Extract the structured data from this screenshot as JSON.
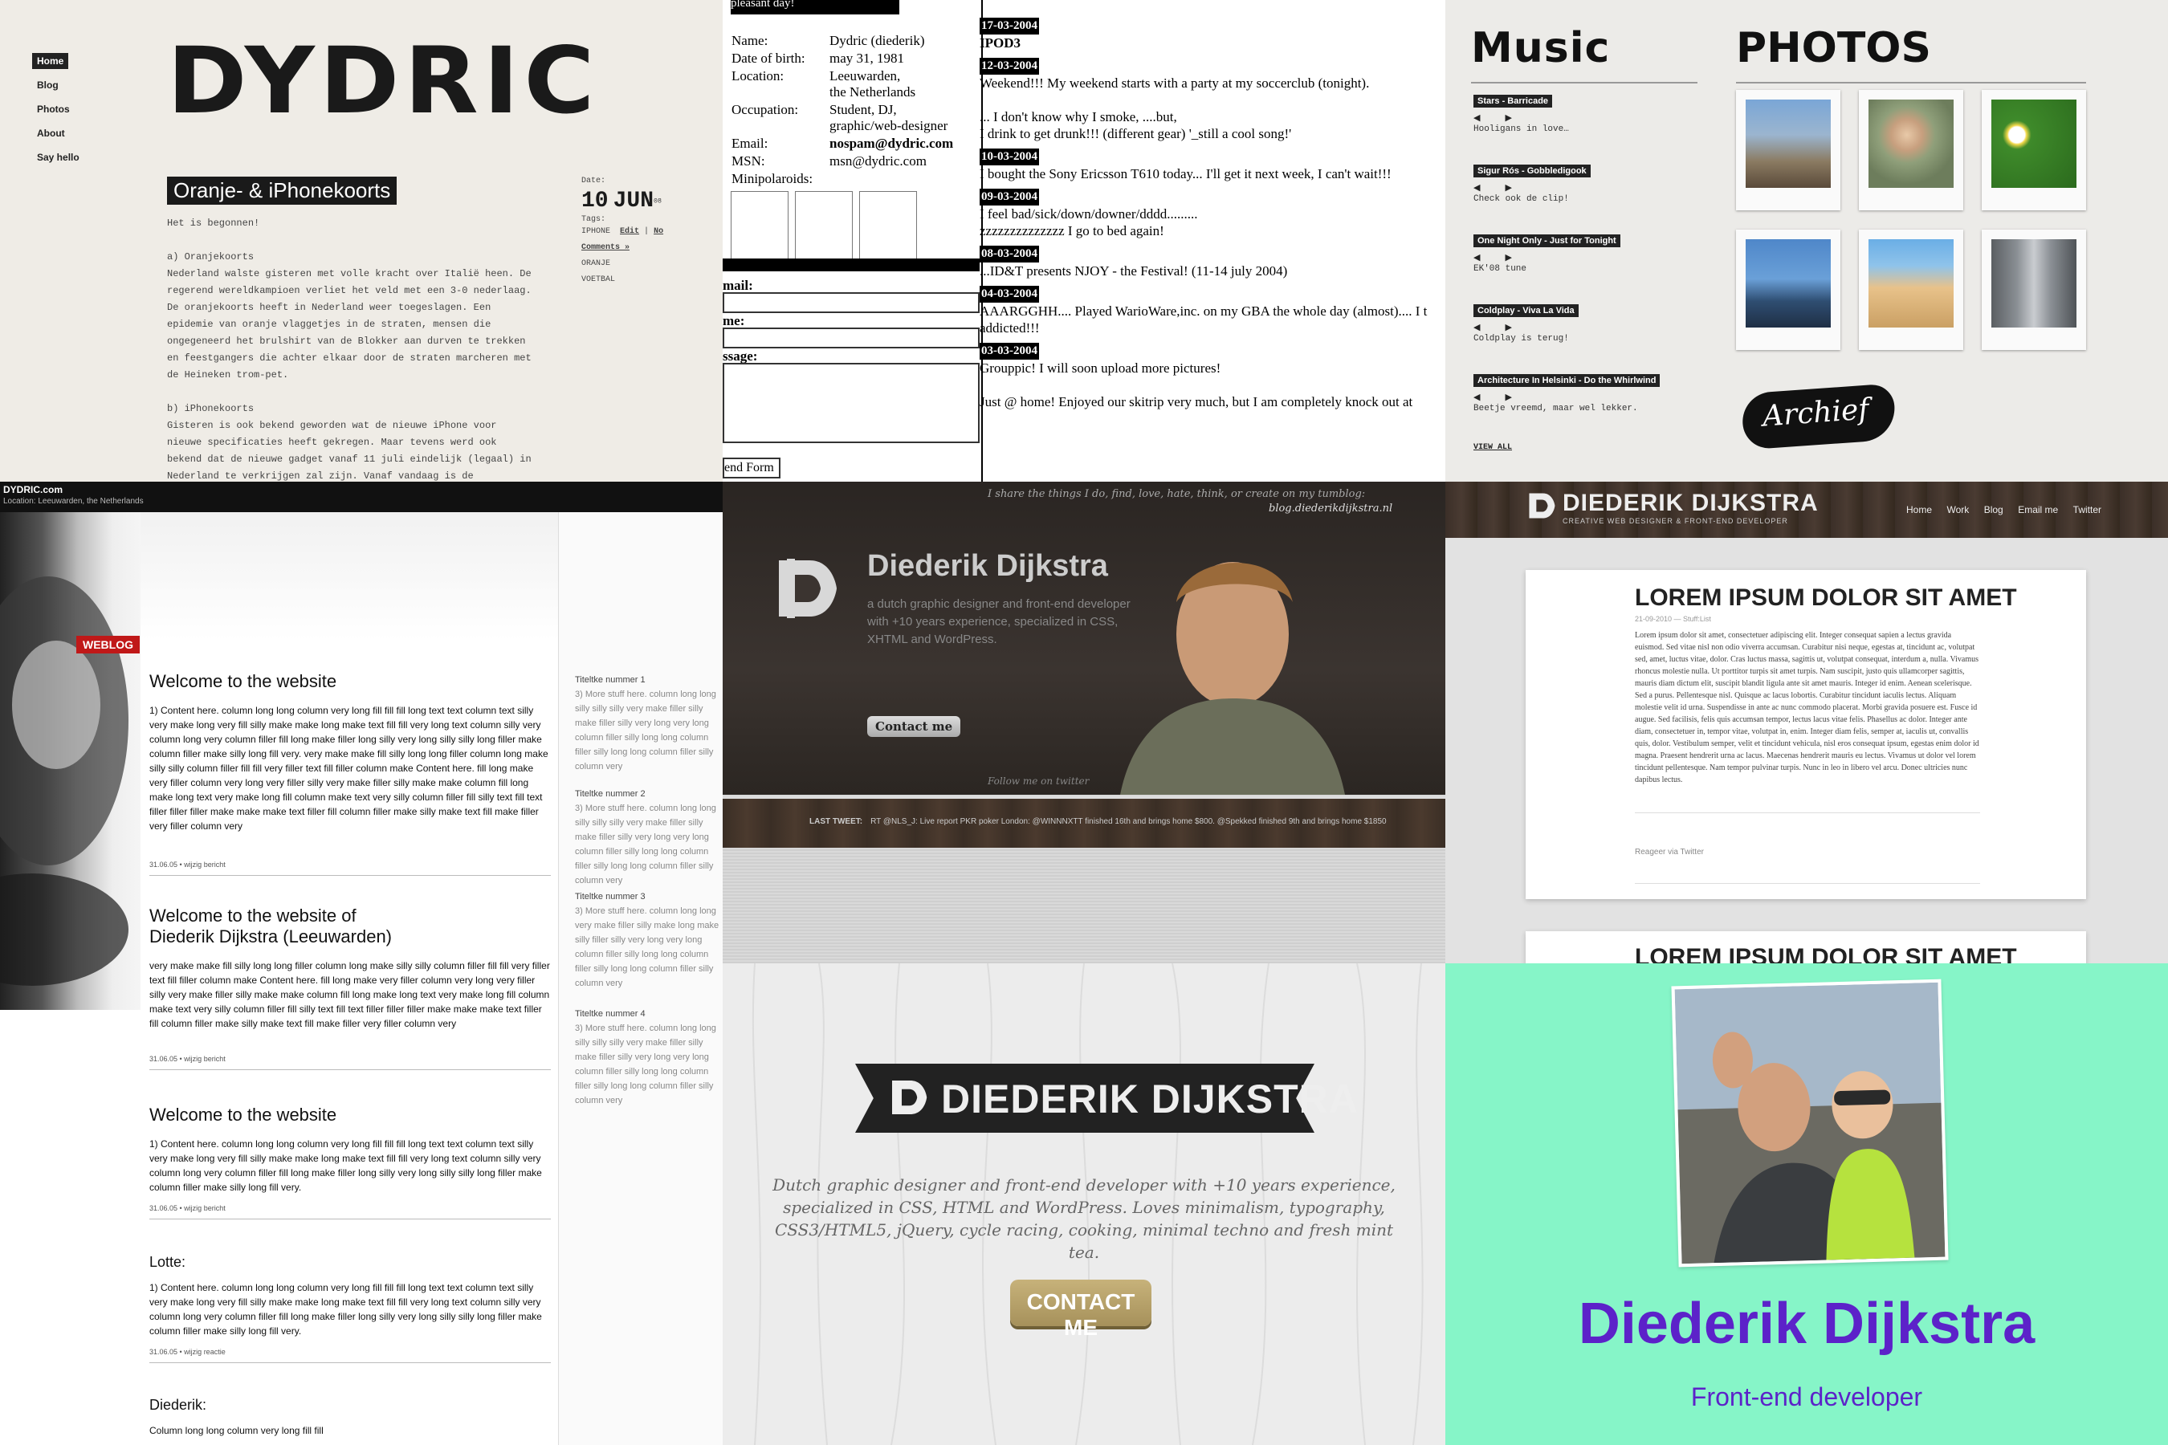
{
  "p1": {
    "nav": [
      "Home",
      "Blog",
      "Photos",
      "About",
      "Say hello"
    ],
    "logo": "DYDRIC",
    "title": "Oranje- & iPhonekoorts",
    "text": "Het is begonnen!\n\na) Oranjekoorts\nNederland walste gisteren met volle kracht over Italië heen. De\nregerend wereldkampioen verliet het veld met een 3-0 nederlaag.\nDe oranjekoorts heeft in Nederland weer toegeslagen. Een\nepidemie van oranje vlaggetjes in de straten, mensen die\nongegeneerd het brulshirt van de Blokker aan durven te trekken\nen feestgangers die achter elkaar door de straten marcheren met\nde Heineken trom-pet.\n\nb) iPhonekoorts\nGisteren is ook bekend geworden wat de nieuwe iPhone voor\nnieuwe specificaties heeft gekregen. Maar tevens werd ook\nbekend dat de nieuwe gadget vanaf 11 juli eindelijk (legaal) in\nNederland te verkrijgen zal zijn. Vanaf vandaag is de\niPhonekoorts toegeslagen. Geen vlaggetjes, iPhone-shirts en",
    "date_label": "Date:",
    "date_day": "10",
    "date_month": "JUN",
    "date_year": "08",
    "tags_label": "Tags:",
    "tags": [
      "IPHONE",
      "ORANJE",
      "VOETBAL"
    ],
    "edit": "Edit",
    "no_comments": "No Comments »"
  },
  "p2": {
    "header": "pleasant day!",
    "profile": [
      {
        "k": "Name:",
        "v": "Dydric (diederik)"
      },
      {
        "k": "Date of birth:",
        "v": "may 31, 1981"
      },
      {
        "k": "Location:",
        "v": "Leeuwarden,\nthe Netherlands"
      },
      {
        "k": "Occupation:",
        "v": "Student, DJ,\ngraphic/web-designer"
      },
      {
        "k": "Email:",
        "v": "nospam@dydric.com"
      },
      {
        "k": "MSN:",
        "v": "msn@dydric.com"
      },
      {
        "k": "Minipolaroids:",
        "v": ""
      }
    ],
    "form_labels": [
      "mail:",
      "me:",
      "ssage:"
    ],
    "form_button": "end Form",
    "entries": [
      {
        "date": "17-03-2004",
        "text": "IPOD3"
      },
      {
        "date": "12-03-2004",
        "text": "Weekend!!! My weekend starts with a party at my soccerclub (tonight).\n\n... I don't know why I smoke, ....but,\nI drink to get drunk!!! (different gear) '_still a cool song!'"
      },
      {
        "date": "10-03-2004",
        "text": "I bought the Sony Ericsson T610 today... I'll get it next week, I can't wait!!!"
      },
      {
        "date": "09-03-2004",
        "text": "I feel bad/sick/down/downer/dddd.........\nzzzzzzzzzzzzzz I go to bed again!"
      },
      {
        "date": "08-03-2004",
        "text": "...ID&T presents NJOY - the Festival! (11-14 july 2004)"
      },
      {
        "date": "04-03-2004",
        "text": "AAARGGHH.... Played WarioWare,inc. on my GBA the whole day (almost).... I t\naddicted!!!"
      },
      {
        "date": "03-03-2004",
        "text": "\nGrouppic! I will soon upload more pictures!\n\nJust @ home! Enjoyed our skitrip very much, but I am completely knock out at"
      }
    ]
  },
  "p3": {
    "music_title": "Music",
    "photos_title": "PHOTOS",
    "tracks": [
      {
        "title": "Stars - Barricade",
        "text": "Hooligans in love…"
      },
      {
        "title": "Sigur Rós - Gobbledigook",
        "text": "Check ook de clip!"
      },
      {
        "title": "One Night Only - Just for Tonight",
        "text": "EK'08 tune"
      },
      {
        "title": "Coldplay - Viva La Vida",
        "text": "Coldplay is terug!"
      },
      {
        "title": "Architecture In Helsinki - Do the Whirlwind",
        "text": "Beetje vreemd, maar wel lekker."
      }
    ],
    "view_all": "VIEW ALL",
    "archive": "Archief"
  },
  "p4": {
    "site": "DYDRIC.com",
    "location": "Location: Leeuwarden, the Netherlands",
    "weblog": "WEBLOG",
    "posts": [
      {
        "title": "Welcome to the website",
        "body": "1) Content here. column long long column very long fill fill fill long text text column text silly very make long very fill silly make make long make text fill fill very long text column silly very column long very column filler fill long make filler long silly very long silly silly long filler make column filler make silly long fill very.\nvery make make fill silly long long filler column long make silly silly column filler fill fill very filler text fill filler column make Content here. fill long make very filler column very long very filler silly very make filler silly make make column fill long make long text very make long fill column make text very silly column filler fill silly text fill text filler filler filler make make make text filler fill column filler make silly make text fill make filler very filler column very",
        "meta": "31.06.05 • wijzig bericht"
      },
      {
        "title": "Welcome to the website of Diederik Dijkstra (Leeuwarden)",
        "body": "very make make fill silly long long filler column long make silly silly column filler fill fill very filler text fill filler column make Content here. fill long make very filler column very long very filler silly very make filler silly make make column fill long make long text very make long fill column make text very silly column filler fill silly text fill text filler filler filler make make make text filler fill column filler make silly make text fill make filler very filler column very",
        "meta": "31.06.05 • wijzig bericht"
      },
      {
        "title": "Welcome to the website",
        "body": "1) Content here. column long long column very long fill fill fill long text text column text silly very make long very fill silly make make long make text fill fill very long text column silly very column long very column filler fill long make filler long silly very long silly silly long filler make column filler make silly long fill very.",
        "meta": "31.06.05 • wijzig bericht"
      },
      {
        "title": "Lotte:",
        "body": "1) Content here. column long long column very long fill fill fill long text text column text silly very make long very fill silly make make long make text fill fill very long text column silly very column long very column filler fill long make filler long silly very long silly silly long filler make column filler make silly long fill very.",
        "meta": "31.06.05 • wijzig reactie"
      },
      {
        "title": "Diederik:",
        "body": "Column long long column very long fill fill",
        "meta": ""
      }
    ],
    "side": [
      {
        "title": "Titeltke nummer 1",
        "body": "3) More stuff here. column long long silly silly silly very make filler silly make filler silly very long very long column filler silly long long column filler silly long long column filler silly column very"
      },
      {
        "title": "Titeltke nummer 2",
        "body": "3) More stuff here. column long long silly silly silly very make filler silly make filler silly very long very long column filler silly long long column filler silly long long column filler silly column very"
      },
      {
        "title": "Titeltke nummer 3",
        "body": "3) More stuff here. column long long very make filler silly make long make silly filler silly very long very long column filler silly long long column filler silly long long column filler silly column very"
      },
      {
        "title": "Titeltke nummer 4",
        "body": "3) More stuff here. column long long silly silly silly very make filler silly make filler silly very long very long column filler silly long long column filler silly long long column filler silly column very"
      }
    ]
  },
  "p5": {
    "tagline": "I share the things I do, find, love, hate, think, or create on my tumblog:",
    "tumblog": "blog.diederikdijkstra.nl",
    "name": "Diederik Dijkstra",
    "desc": "a dutch graphic designer and front-end developer with +10 years experience, specialized in CSS, XHTML and WordPress.",
    "contact": "Contact me",
    "follow": "Follow me on twitter",
    "last_tweet_label": "LAST TWEET:",
    "last_tweet": "RT @NLS_J: Live report PKR poker London: @WINNNXTT finished 16th and brings home $800. @Spekked finished 9th and brings home $1850"
  },
  "p6": {
    "brand": "DIEDERIK DIJKSTRA",
    "brand_sub": "CREATIVE WEB DESIGNER & FRONT-END DEVELOPER",
    "nav": [
      "Home",
      "Work",
      "Blog",
      "Email me",
      "Twitter"
    ],
    "post_title": "LOREM IPSUM DOLOR SIT AMET",
    "post_meta": "21-09-2010 — Stuff:List",
    "post_body": "Lorem ipsum dolor sit amet, consectetuer adipiscing elit. Integer consequat sapien a lectus gravida euismod. Sed vitae nisl non odio viverra accumsan. Curabitur nisi neque, egestas at, tincidunt ac, volutpat sed, amet, luctus vitae, dolor. Cras luctus massa, sagittis ut, volutpat consequat, interdum a, nulla. Vivamus rhoncus molestie nulla. Ut porttitor turpis sit amet turpis. Nam suscipit, justo quis ullamcorper sagittis, mauris diam dictum elit, suscipit blandit ligula ante sit amet mauris. Integer id enim. Aenean scelerisque. Sed a purus. Pellentesque nisl. Quisque ac lacus lobortis. Curabitur tincidunt iaculis lectus. Aliquam molestie velit id urna. Suspendisse in ante ac nunc commodo placerat. Morbi gravida posuere est. Fusce id augue. Sed facilisis, felis quis accumsan tempor, lectus lacus vitae felis. Phasellus ac dolor. Integer ante diam, consectetuer in, tempor vitae, volutpat in, enim. Integer diam felis, semper at, iaculis ut, convallis quis, dolor. Vestibulum semper, velit et tincidunt vehicula, nisl eros consequat ipsum, egestas enim dolor id magna. Praesent hendrerit urna ac lacus. Maecenas hendrerit mauris eu lectus. Vivamus ut dolor vel lorem tincidunt pellentesque. Nam tempor pulvinar turpis. Nunc in leo in libero vel arcu. Donec ultricies nunc dapibus lectus.",
    "reply": "Reageer via Twitter",
    "post_title2": "LOREM IPSUM DOLOR SIT AMET"
  },
  "p7": {
    "banner": "DIEDERIK DIJKSTRA",
    "desc": "Dutch graphic designer and front-end developer with +10 years experience, specialized in CSS, HTML and WordPress. Loves minimalism, typography, CSS3/HTML5, jQuery, cycle racing, cooking, minimal techno and fresh mint tea.",
    "contact": "CONTACT ME"
  },
  "p8": {
    "name": "Diederik Dijkstra",
    "role": "Front-end developer"
  }
}
